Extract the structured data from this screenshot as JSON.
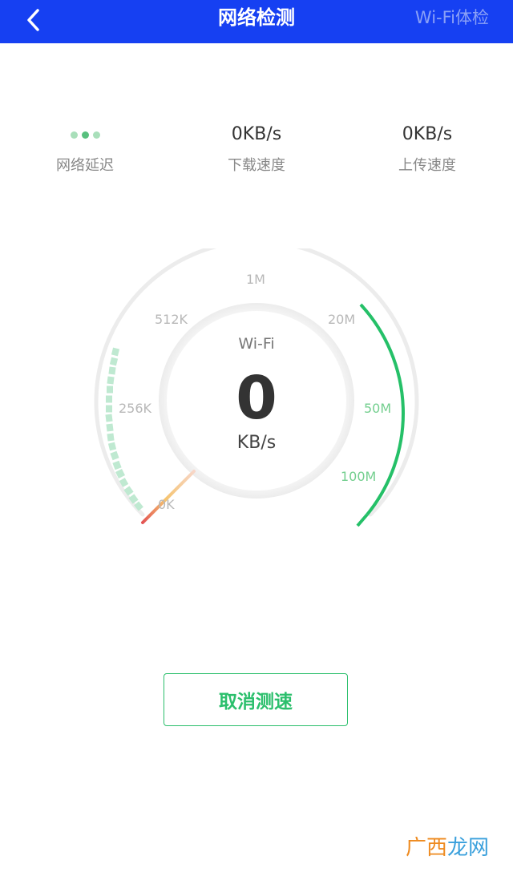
{
  "header": {
    "back_icon": "chevron-left-icon",
    "title": "网络检测",
    "right_link": "Wi-Fi体检",
    "bg_color": "#1640f2"
  },
  "stats": {
    "latency": {
      "label": "网络延迟",
      "indicator": "three-dot-loading-icon"
    },
    "download": {
      "value": "0KB/s",
      "label": "下载速度"
    },
    "upload": {
      "value": "0KB/s",
      "label": "上传速度"
    }
  },
  "gauge": {
    "network": "Wi-Fi",
    "value": "0",
    "unit": "KB/s",
    "scale_labels": [
      "0K",
      "256K",
      "512K",
      "1M",
      "20M",
      "50M",
      "100M"
    ],
    "accent_color": "#25c068",
    "needle_colors": [
      "#e35454",
      "#f7c98a"
    ]
  },
  "actions": {
    "cancel_label": "取消测速"
  },
  "watermark": {
    "part1": "广",
    "part2": "西",
    "part3": "龙网"
  }
}
